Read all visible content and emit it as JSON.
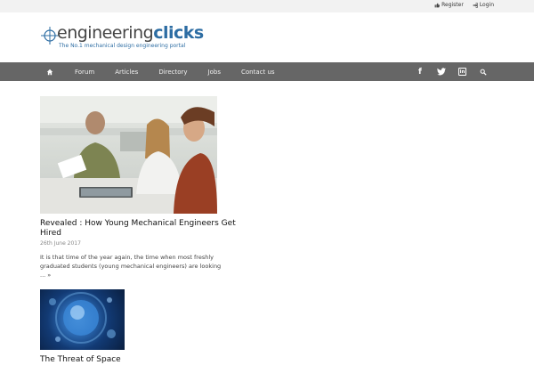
{
  "topbar": {
    "register_label": "Register",
    "login_label": "Login"
  },
  "logo": {
    "word_part1": "engineering",
    "word_part2": "clicks",
    "tagline": "The No.1 mechanical design engineering portal"
  },
  "nav": {
    "items": [
      {
        "label": "Forum"
      },
      {
        "label": "Articles"
      },
      {
        "label": "Directory"
      },
      {
        "label": "Jobs"
      },
      {
        "label": "Contact us"
      }
    ]
  },
  "social": {
    "facebook": "f",
    "linkedin": "in"
  },
  "articles": [
    {
      "title": "Revealed : How Young Mechanical Engineers Get Hired",
      "date": "26th June 2017",
      "excerpt": "It is that time of the year again, the time when most freshly graduated students (young mechanical engineers) are looking",
      "readmore": "... »"
    },
    {
      "title": "The Threat of Space"
    }
  ],
  "colors": {
    "navbar": "#666666",
    "topbar": "#f2f2f2",
    "brand_blue": "#2d6da3"
  }
}
